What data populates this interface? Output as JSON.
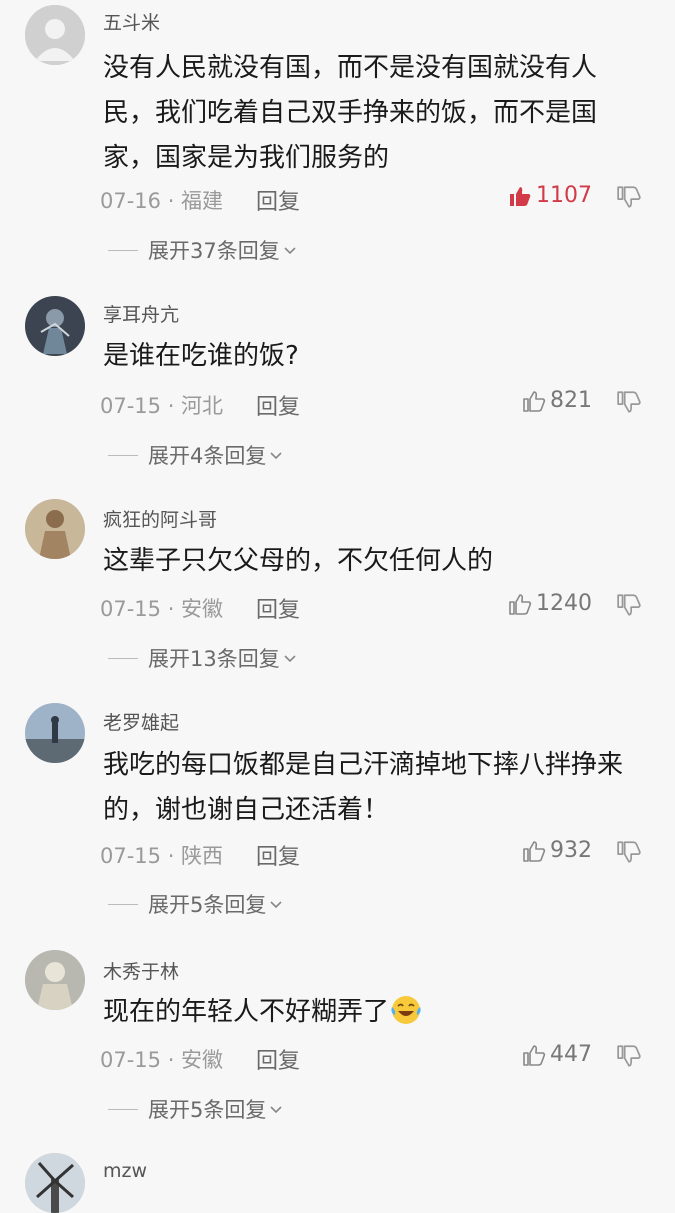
{
  "comments": [
    {
      "user": "五斗米",
      "text_lines": [
        "没有人民就没有国，而不是没有国就没有人",
        "民，我们吃着自己双手挣来的饭，而不是国",
        "家，国家是为我们服务的"
      ],
      "meta": "07-16 · 福建",
      "reply_label": "回复",
      "likes": "1107",
      "expand": "展开37条回复"
    },
    {
      "user": "享耳舟亢",
      "text_lines": [
        "是谁在吃谁的饭?"
      ],
      "meta": "07-15 · 河北",
      "reply_label": "回复",
      "likes": "821",
      "expand": "展开4条回复"
    },
    {
      "user": "疯狂的阿斗哥",
      "text_lines": [
        "这辈子只欠父母的，不欠任何人的"
      ],
      "meta": "07-15 · 安徽",
      "reply_label": "回复",
      "likes": "1240",
      "expand": "展开13条回复"
    },
    {
      "user": "老罗雄起",
      "text_lines": [
        "我吃的每口饭都是自己汗滴掉地下摔八拌挣来",
        "的，谢也谢自己还活着！"
      ],
      "meta": "07-15 · 陕西",
      "reply_label": "回复",
      "likes": "932",
      "expand": "展开5条回复"
    },
    {
      "user": "木秀于林",
      "text_lines": [
        "现在的年轻人不好糊弄了"
      ],
      "emoji": "laughing-tears-emoji",
      "meta": "07-15 · 安徽",
      "reply_label": "回复",
      "likes": "447",
      "expand": "展开5条回复"
    },
    {
      "user": "mzw"
    }
  ],
  "colors": {
    "like_active": "#d23a47",
    "meta_gray": "#9a9a9a",
    "background": "#f7f7f7"
  }
}
